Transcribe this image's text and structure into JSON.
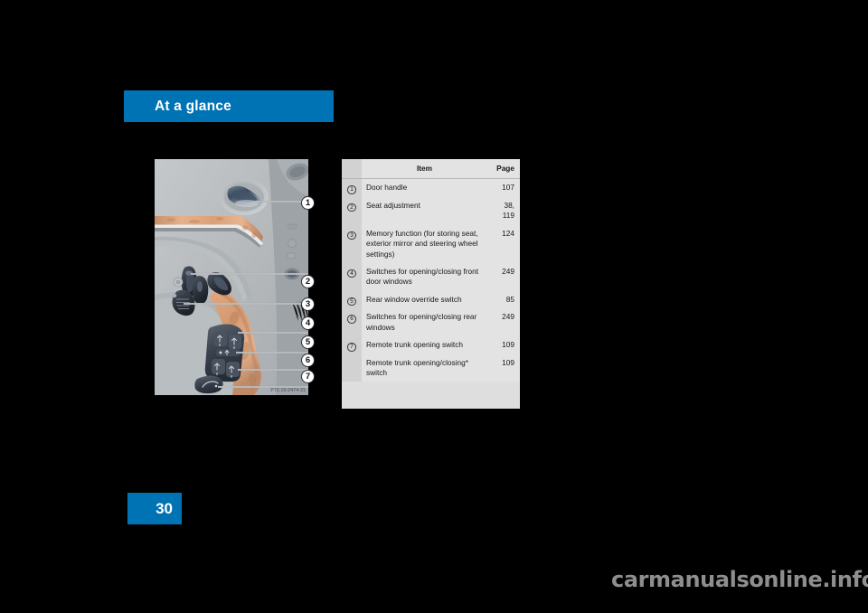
{
  "section": {
    "banner_label": "At a glance",
    "banner_color": "#0073b5"
  },
  "page": {
    "number": "30",
    "number_block_color": "#0073b5"
  },
  "illustration": {
    "caption": "P72.10-2474-31",
    "alt_name": "driver-door-panel-diagram",
    "callouts": [
      {
        "number": "1",
        "target": "door-handle"
      },
      {
        "number": "2",
        "target": "seat-adjustment"
      },
      {
        "number": "3",
        "target": "memory-function"
      },
      {
        "number": "4",
        "target": "front-window-switches"
      },
      {
        "number": "5",
        "target": "rear-window-override"
      },
      {
        "number": "6",
        "target": "rear-window-switches"
      },
      {
        "number": "7",
        "target": "remote-trunk-switch"
      }
    ]
  },
  "table": {
    "headers": {
      "num": "",
      "item": "Item",
      "page": "Page"
    },
    "rows": [
      {
        "num": "1",
        "item": "Door handle",
        "page": "107"
      },
      {
        "num": "2",
        "item": "Seat adjustment",
        "page": "38,\n119"
      },
      {
        "num": "3",
        "item": "Memory function (for storing seat, exterior mirror and steering wheel settings)",
        "page": "124"
      },
      {
        "num": "4",
        "item": "Switches for opening/closing front door windows",
        "page": "249"
      },
      {
        "num": "5",
        "item": "Rear window override switch",
        "page": "85"
      },
      {
        "num": "6",
        "item": "Switches for opening/closing rear windows",
        "page": "249"
      },
      {
        "num": "7",
        "item": "Remote trunk opening switch",
        "page": "109"
      },
      {
        "num": "",
        "item": "Remote trunk opening/closing* switch",
        "page": "109"
      }
    ]
  },
  "watermark": {
    "text": "carmanualsonline.info"
  }
}
